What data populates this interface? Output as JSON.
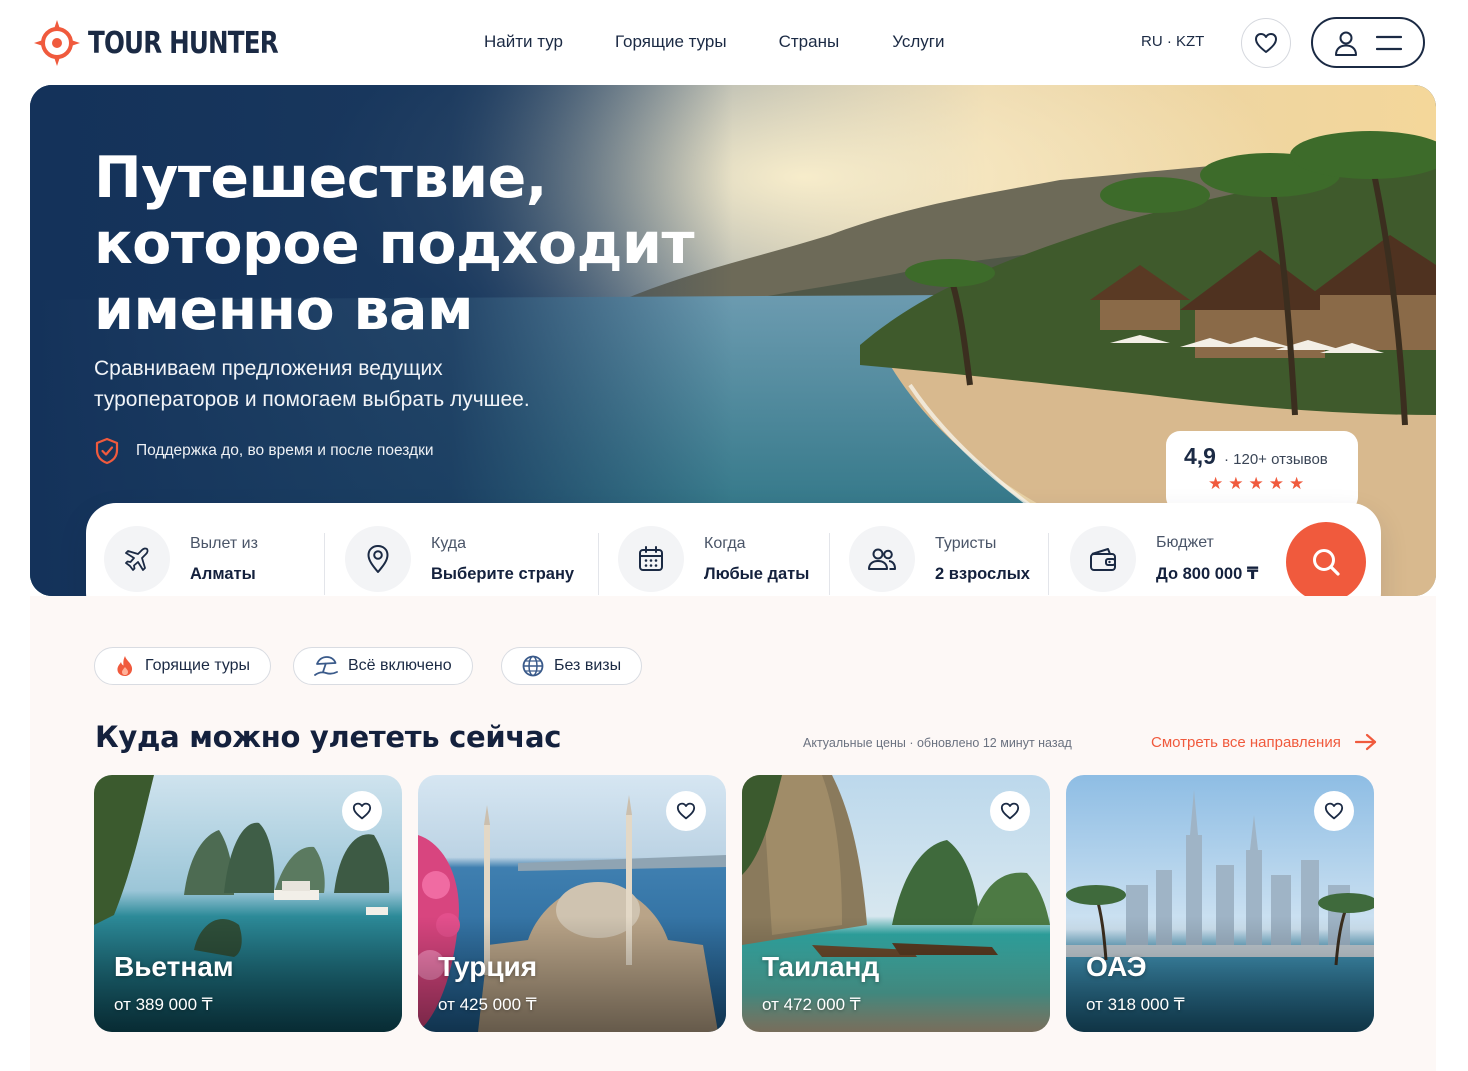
{
  "brand": {
    "name": "TOUR HUNTER",
    "accent": "#f05a3d",
    "navy": "#14213d"
  },
  "nav": {
    "items": [
      "Найти тур",
      "Горящие туры",
      "Страны",
      "Услуги"
    ]
  },
  "locale": {
    "text": "RU · KZT"
  },
  "icons": {
    "logo": "crosshair-icon",
    "favorites": "heart-icon",
    "profile": "user-icon",
    "menu": "hamburger-icon",
    "support": "shield-check-icon",
    "departure": "plane-icon",
    "destination": "map-pin-icon",
    "dates": "calendar-icon",
    "tourists": "users-icon",
    "budget": "wallet-icon",
    "search": "search-icon"
  },
  "hero": {
    "title_lines": [
      "Путешествие,",
      "которое подходит",
      "именно вам"
    ],
    "subtitle_lines": [
      "Сравниваем предложения ведущих",
      "туроператоров и помогаем выбрать лучшее."
    ],
    "support": "Поддержка до, во время и после поездки",
    "rating": {
      "score": "4,9",
      "reviews": "· 120+ отзывов",
      "stars": 5
    }
  },
  "search": {
    "from": {
      "label": "Вылет из",
      "value": "Алматы"
    },
    "to": {
      "label": "Куда",
      "value": "Выберите страну"
    },
    "when": {
      "label": "Когда",
      "value": "Любые даты"
    },
    "tourists": {
      "label": "Туристы",
      "value": "2 взрослых"
    },
    "budget": {
      "label": "Бюджет",
      "value": "До 800 000 ₸"
    }
  },
  "chips": [
    "Горящие туры",
    "Всё включено",
    "Без визы"
  ],
  "destinations": {
    "title": "Куда можно улететь сейчас",
    "meta": "Актуальные цены  ·  обновлено 12 минут назад",
    "link": "Смотреть все направления",
    "cards": [
      {
        "name": "Вьетнам",
        "price": "от 389 000 ₸"
      },
      {
        "name": "Турция",
        "price": "от 425 000 ₸"
      },
      {
        "name": "Таиланд",
        "price": "от 472 000 ₸"
      },
      {
        "name": "ОАЭ",
        "price": "от 318 000 ₸"
      }
    ]
  }
}
